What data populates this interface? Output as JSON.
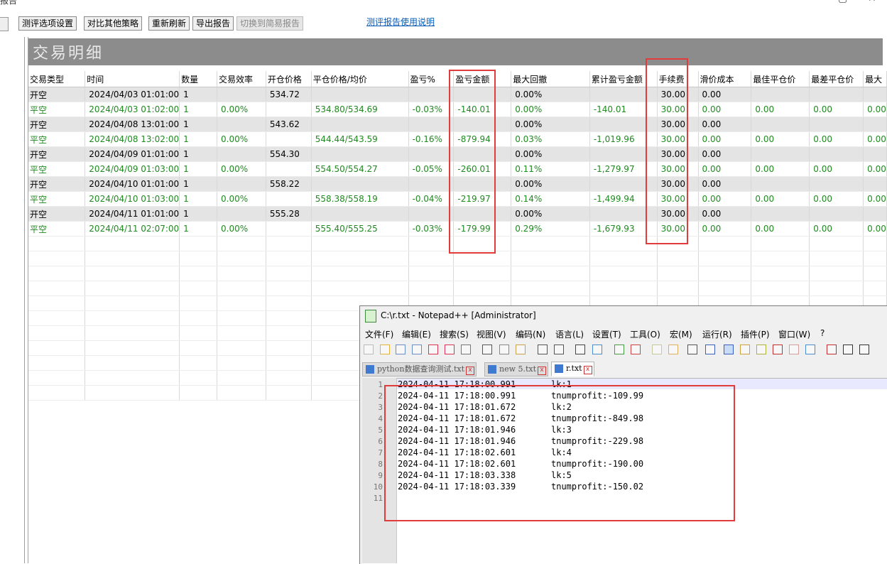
{
  "window": {
    "title_fragment": "报告"
  },
  "toolbar": {
    "buttons": [
      "测评选项设置",
      "对比其他策略",
      "重新刷新",
      "导出报告",
      "切换到简易报告"
    ],
    "help_link": "测评报告使用说明"
  },
  "section": {
    "title": "交易明细"
  },
  "table": {
    "columns": [
      "交易类型",
      "时间",
      "数量",
      "交易效率",
      "开仓价格",
      "平仓价格/均价",
      "盈亏%",
      "盈亏金额",
      "最大回撤",
      "累计盈亏金额",
      "手续费",
      "滑价成本",
      "最佳平仓价",
      "最差平仓价",
      "最大"
    ],
    "rows": [
      [
        "开空",
        "2024/04/03 01:01:00",
        "1",
        "",
        "534.72",
        "",
        "",
        "",
        "0.00%",
        "",
        "30.00",
        "0.00",
        "",
        "",
        ""
      ],
      [
        "平空",
        "2024/04/03 01:02:00",
        "1",
        "0.00%",
        "",
        "534.80/534.69",
        "-0.03%",
        "-140.01",
        "0.00%",
        "-140.01",
        "30.00",
        "0.00",
        "0.00",
        "0.00",
        "0.00"
      ],
      [
        "开空",
        "2024/04/08 13:01:00",
        "1",
        "",
        "543.62",
        "",
        "",
        "",
        "0.00%",
        "",
        "30.00",
        "0.00",
        "",
        "",
        ""
      ],
      [
        "平空",
        "2024/04/08 13:02:00",
        "1",
        "0.00%",
        "",
        "544.44/543.59",
        "-0.16%",
        "-879.94",
        "0.03%",
        "-1,019.96",
        "30.00",
        "0.00",
        "0.00",
        "0.00",
        "0.00"
      ],
      [
        "开空",
        "2024/04/09 01:01:00",
        "1",
        "",
        "554.30",
        "",
        "",
        "",
        "0.00%",
        "",
        "30.00",
        "0.00",
        "",
        "",
        ""
      ],
      [
        "平空",
        "2024/04/09 01:03:00",
        "1",
        "0.00%",
        "",
        "554.50/554.27",
        "-0.05%",
        "-260.01",
        "0.11%",
        "-1,279.97",
        "30.00",
        "0.00",
        "0.00",
        "0.00",
        "0.00"
      ],
      [
        "开空",
        "2024/04/10 01:01:00",
        "1",
        "",
        "558.22",
        "",
        "",
        "",
        "0.00%",
        "",
        "30.00",
        "0.00",
        "",
        "",
        ""
      ],
      [
        "平空",
        "2024/04/10 01:03:00",
        "1",
        "0.00%",
        "",
        "558.38/558.19",
        "-0.04%",
        "-219.97",
        "0.14%",
        "-1,499.94",
        "30.00",
        "0.00",
        "0.00",
        "0.00",
        "0.00"
      ],
      [
        "开空",
        "2024/04/11 01:01:00",
        "1",
        "",
        "555.28",
        "",
        "",
        "",
        "0.00%",
        "",
        "30.00",
        "0.00",
        "",
        "",
        ""
      ],
      [
        "平空",
        "2024/04/11 02:07:00",
        "1",
        "0.00%",
        "",
        "555.40/555.25",
        "-0.03%",
        "-179.99",
        "0.29%",
        "-1,679.93",
        "30.00",
        "0.00",
        "0.00",
        "0.00",
        "0.00"
      ]
    ]
  },
  "notepad": {
    "title": "C:\\r.txt - Notepad++ [Administrator]",
    "menu": [
      "文件(F)",
      "编辑(E)",
      "搜索(S)",
      "视图(V)",
      "编码(N)",
      "语言(L)",
      "设置(T)",
      "工具(O)",
      "宏(M)",
      "运行(R)",
      "插件(P)",
      "窗口(W)",
      "?"
    ],
    "tabs": [
      "python数据查询测试.txt",
      "new 5.txt",
      "r.txt"
    ],
    "lines": [
      [
        "2024-04-11 17:18:00.991",
        "lk:1"
      ],
      [
        "2024-04-11 17:18:00.991",
        "tnumprofit:-109.99"
      ],
      [
        "2024-04-11 17:18:01.672",
        "lk:2"
      ],
      [
        "2024-04-11 17:18:01.672",
        "tnumprofit:-849.98"
      ],
      [
        "2024-04-11 17:18:01.946",
        "lk:3"
      ],
      [
        "2024-04-11 17:18:01.946",
        "tnumprofit:-229.98"
      ],
      [
        "2024-04-11 17:18:02.601",
        "lk:4"
      ],
      [
        "2024-04-11 17:18:02.601",
        "tnumprofit:-190.00"
      ],
      [
        "2024-04-11 17:18:03.338",
        "lk:5"
      ],
      [
        "2024-04-11 17:18:03.339",
        "tnumprofit:-150.02"
      ],
      [
        "",
        ""
      ]
    ]
  },
  "colors": {
    "highlight_box": "#e23b3b",
    "close_row_text": "#1f8a1f",
    "open_row_bg": "#e4e4e4",
    "header_bar": "#8c8c8c",
    "link": "#0b5bb5"
  }
}
